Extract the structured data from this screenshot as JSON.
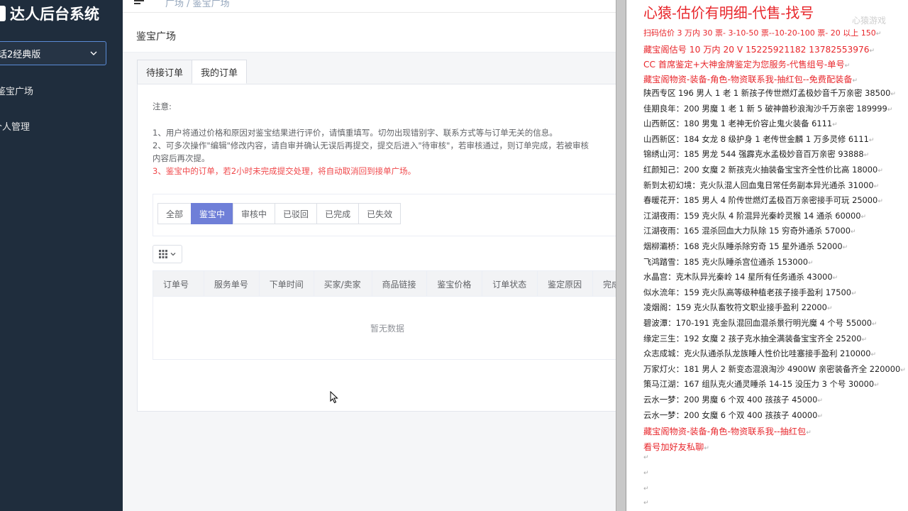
{
  "sidebar": {
    "brand": "达人后台系统",
    "version": "话2经典版",
    "items": [
      {
        "label": "鉴宝广场"
      },
      {
        "label": "个人管理"
      }
    ]
  },
  "topbar": {
    "breadcrumb": "广场  /  鉴宝广场"
  },
  "page": {
    "title": "鉴宝广场",
    "tabs": [
      {
        "label": "待接订单"
      },
      {
        "label": "我的订单"
      }
    ],
    "notes": {
      "title": "注意:",
      "line1": "1、用户将通过价格和原因对鉴宝结果进行评价，请慎重填写。切勿出现错别字、联系方式等与订单无关的信息。",
      "line2": "2、可多次操作\"编辑\"修改内容，请自审并确认无误后再提交，提交后进入\"待审核\"，若审核通过，则订单完成，若被审核",
      "line2b": "内容后再次提。",
      "line3": "3、鉴宝中的订单，若2小时未完成提交处理，将自动取消回到接单广场。"
    },
    "filters": [
      {
        "label": "全部"
      },
      {
        "label": "鉴宝中"
      },
      {
        "label": "审核中"
      },
      {
        "label": "已驳回"
      },
      {
        "label": "已完成"
      },
      {
        "label": "已失效"
      }
    ],
    "table": {
      "columns": [
        "订单号",
        "服务单号",
        "下单时间",
        "买家/卖家",
        "商品链接",
        "鉴宝价格",
        "订单状态",
        "鉴定原因",
        "完成"
      ],
      "empty": "暂无数据"
    }
  },
  "doc": {
    "title": "心猿-估价有明细-代售-找号",
    "watermark": "心猿游戏",
    "lines": [
      {
        "text": "扫码估价 3 万内 30 票- 3-10-50 票--10-20-100 票- 20 以上 150",
        "style": "small-red"
      },
      {
        "text": "藏宝阁估号 10 万内 20 V 15225921182   13782553976",
        "style": "red"
      },
      {
        "text": "CC 首席鉴定+大神金牌鉴定为您服务-代售组号-单号",
        "style": "red"
      },
      {
        "text": "藏宝阁物资-装备-角色-物资联系我-抽红包--免费配装备",
        "style": "red"
      },
      {
        "text": "陕西专区 196 男人 1 老 1 新孩子传世燃灯孟极妙音千万亲密 38500",
        "style": "normal"
      },
      {
        "text": "佳期良年：200 男魔 1 老 1 新 5 破神兽秒浪淘沙千万亲密 189999",
        "style": "normal"
      },
      {
        "text": "山西新区：180 男鬼 1 老神无价容止鬼火装备 6111",
        "style": "normal"
      },
      {
        "text": "山西新区：184 女龙 8 级护身 1 老传世金麟 1 万多灵修 6111",
        "style": "normal"
      },
      {
        "text": "锦绣山河：185 男龙 544 强霹克水孟极妙音百万亲密 93888",
        "style": "normal"
      },
      {
        "text": "红颜知己：200 女魔 2 新孩克火抽装备宝宝齐全性价比高 18000",
        "style": "normal"
      },
      {
        "text": "新到太初幻境：克火队混人回血鬼日常任务副本异光通杀 31000",
        "style": "normal"
      },
      {
        "text": "春暖花开：185 男人 4 阶传世燃灯孟极百万亲密接手可玩 25000",
        "style": "normal"
      },
      {
        "text": "江湖夜雨：159 克火队 4 阶混异光秦岭灵猴 14 通杀 60000",
        "style": "normal"
      },
      {
        "text": "江湖夜雨：165 混杀回血大力队除 15 穷奇外通杀 57000",
        "style": "normal"
      },
      {
        "text": "烟柳灞桥：168 克火队睡杀除穷奇 15 星外通杀 52000",
        "style": "normal"
      },
      {
        "text": "飞鸿踏雪：185 克火队睡杀宫位通杀 153000",
        "style": "normal"
      },
      {
        "text": "水晶宫：克木队异光秦岭 14 星所有任务通杀 43000",
        "style": "normal"
      },
      {
        "text": "似水流年：159 克火队高等级种植老孩子接手盈利 17500",
        "style": "normal"
      },
      {
        "text": "凌烟阁：159 克火队畜牧符文职业接手盈利 22000",
        "style": "normal"
      },
      {
        "text": "碧波潭：170-191 克金队混回血混杀景行明光魔 4 个号 55000",
        "style": "normal"
      },
      {
        "text": "缘定三生：192 女魔 2 孩子克水抽全满装备宝宝齐全 25200",
        "style": "normal"
      },
      {
        "text": "众志成城：克火队通杀队龙族睡人性价比哇塞接手盈利 210000",
        "style": "normal"
      },
      {
        "text": "万家灯火：181 男人 2 新变态混浪淘沙 4900W 亲密装备齐全 220000",
        "style": "normal"
      },
      {
        "text": "策马江湖：167 组队克火通灵睡杀 14-15 没压力 3 个号 30000",
        "style": "normal"
      },
      {
        "text": "云水一梦：200 男魔 6 个双 400 孩孩子 45000",
        "style": "normal"
      },
      {
        "text": "云水一梦：200 女魔 6 个双 400 孩孩子 40000",
        "style": "normal"
      },
      {
        "text": "藏宝阁物资-装备-角色-物资联系我--抽红包",
        "style": "red"
      },
      {
        "text": "看号加好友私聊",
        "style": "red"
      }
    ]
  }
}
